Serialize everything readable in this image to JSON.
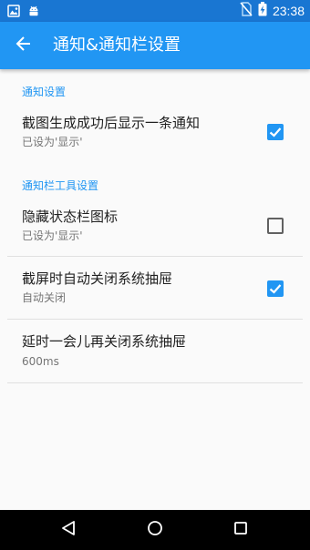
{
  "status_bar": {
    "time": "23:38",
    "left_icons": [
      "image-notification-icon",
      "android-notification-icon"
    ],
    "right_icons": [
      "no-sim-icon",
      "battery-charging-icon"
    ]
  },
  "app_bar": {
    "title": "通知&通知栏设置",
    "back_icon": "arrow-back-icon"
  },
  "sections": [
    {
      "header": "通知设置",
      "items": [
        {
          "title": "截图生成成功后显示一条通知",
          "summary": "已设为'显示'",
          "checked": true
        }
      ]
    },
    {
      "header": "通知栏工具设置",
      "items": [
        {
          "title": "隐藏状态栏图标",
          "summary": "已设为'显示'",
          "checked": false
        },
        {
          "title": "截屏时自动关闭系统抽屉",
          "summary": "自动关闭",
          "checked": true
        },
        {
          "title": "延时一会儿再关闭系统抽屉",
          "summary": "600ms"
        }
      ]
    }
  ],
  "nav_bar": {
    "buttons": [
      "back-triangle-icon",
      "home-circle-icon",
      "recents-square-icon"
    ]
  },
  "colors": {
    "status_bar": "#1976d2",
    "app_bar": "#2196f3",
    "accent": "#2196f3",
    "nav_bar": "#000000"
  }
}
